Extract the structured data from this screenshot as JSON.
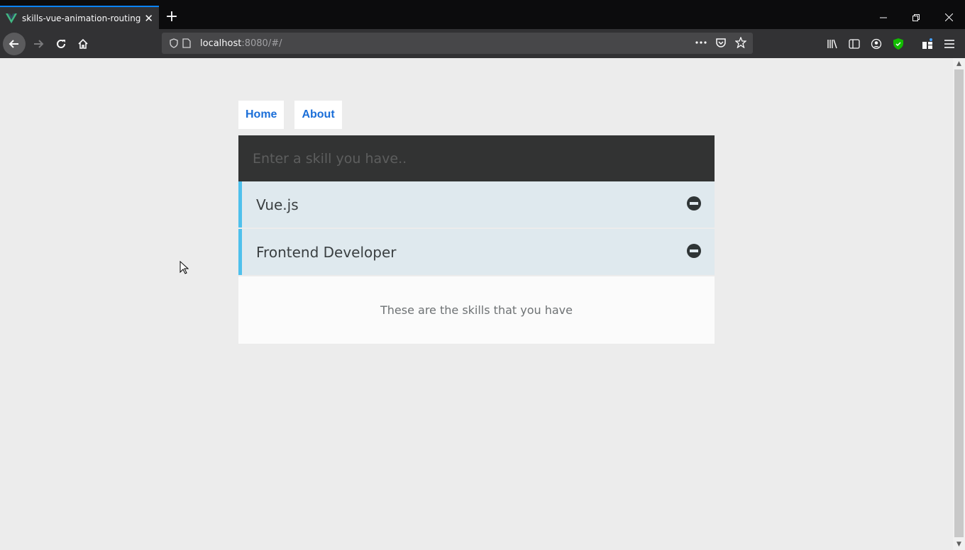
{
  "browser": {
    "tab_title": "skills-vue-animation-routing",
    "new_tab_glyph": "+",
    "close_tab_glyph": "✕",
    "url_host": "localhost",
    "url_rest": ":8080/#/",
    "window_controls": [
      "minimize",
      "restore",
      "close"
    ],
    "accent": "#0a84ff"
  },
  "nav": {
    "links": [
      {
        "label": "Home"
      },
      {
        "label": "About"
      }
    ],
    "link_color": "#1a6ed8"
  },
  "skills": {
    "input_placeholder": "Enter a skill you have..",
    "items": [
      {
        "name": "Vue.js"
      },
      {
        "name": "Frontend Developer"
      }
    ],
    "accent": "#4fc0ec",
    "footer_text": "These are the skills that you have"
  }
}
